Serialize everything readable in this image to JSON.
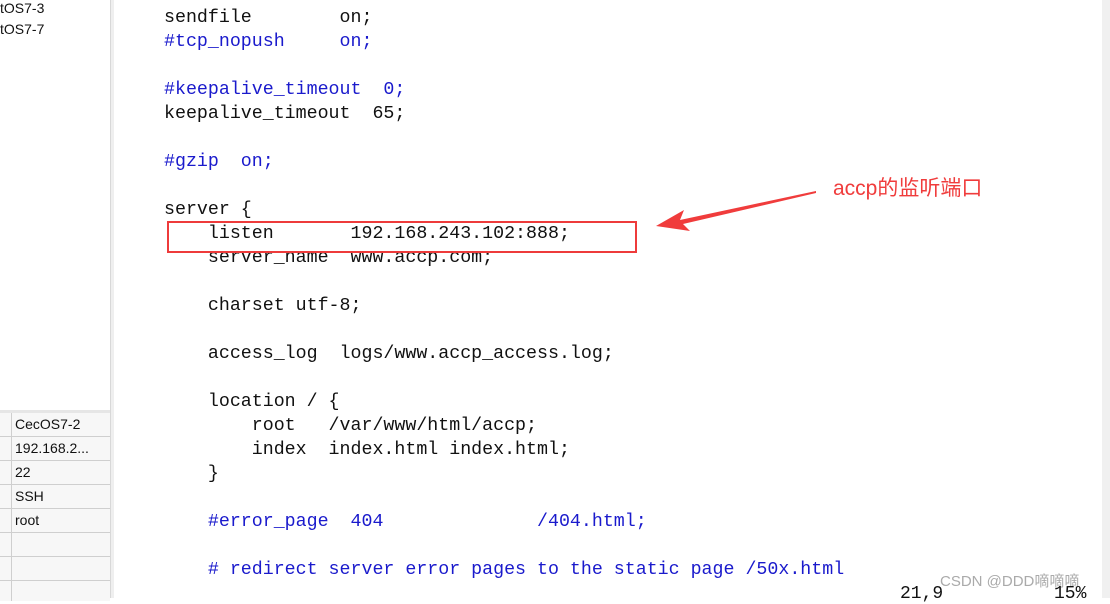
{
  "sessions": [
    "tOS7-3",
    "tOS7-7"
  ],
  "properties": [
    "CecOS7-2",
    "192.168.2...",
    "22",
    "SSH",
    "root",
    "",
    ""
  ],
  "code_lines": [
    {
      "t": "sendfile        on;",
      "c": false
    },
    {
      "t": "#tcp_nopush     on;",
      "c": true
    },
    {
      "t": "",
      "c": false
    },
    {
      "t": "#keepalive_timeout  0;",
      "c": true
    },
    {
      "t": "keepalive_timeout  65;",
      "c": false
    },
    {
      "t": "",
      "c": false
    },
    {
      "t": "#gzip  on;",
      "c": true
    },
    {
      "t": "",
      "c": false
    },
    {
      "t": "server {",
      "c": false
    },
    {
      "t": "    listen       192.168.243.102:888;",
      "c": false
    },
    {
      "t": "    server_name  www.accp.com;",
      "c": false
    },
    {
      "t": "",
      "c": false
    },
    {
      "t": "    charset utf-8;",
      "c": false
    },
    {
      "t": "",
      "c": false
    },
    {
      "t": "    access_log  logs/www.accp_access.log;",
      "c": false
    },
    {
      "t": "",
      "c": false
    },
    {
      "t": "    location / {",
      "c": false
    },
    {
      "t": "        root   /var/www/html/accp;",
      "c": false
    },
    {
      "t": "        index  index.html index.html;",
      "c": false
    },
    {
      "t": "    }",
      "c": false
    },
    {
      "t": "",
      "c": false
    },
    {
      "t": "    #error_page  404              /404.html;",
      "c": true
    },
    {
      "t": "",
      "c": false
    },
    {
      "t": "    # redirect server error pages to the static page /50x.html",
      "c": true
    }
  ],
  "annotation": "accp的监听端口",
  "annotation_color": "#f03c3c",
  "comment_color": "#1a1acc",
  "status": {
    "position": "21,9",
    "percent": "15%"
  },
  "watermark": "CSDN @DDD嘀嘀嘀"
}
